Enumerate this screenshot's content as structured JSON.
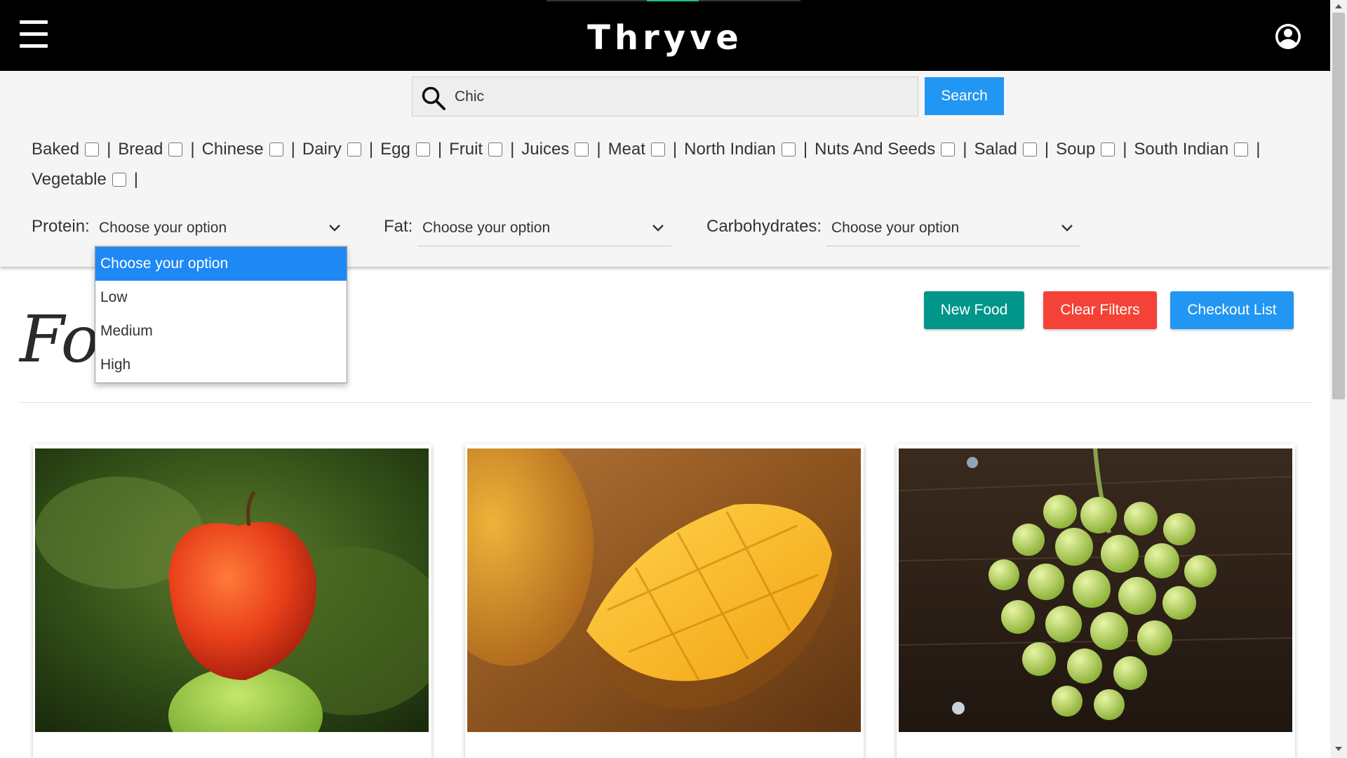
{
  "header": {
    "brand": "Thryve",
    "menu_icon": "hamburger-menu-icon",
    "account_icon": "user-circle-icon"
  },
  "search": {
    "value": "Chic",
    "icon": "search-icon",
    "button_label": "Search"
  },
  "categories": [
    "Baked",
    "Bread",
    "Chinese",
    "Dairy",
    "Egg",
    "Fruit",
    "Juices",
    "Meat",
    "North Indian",
    "Nuts And Seeds",
    "Salad",
    "Soup",
    "South Indian",
    "Vegetable"
  ],
  "separator": "|",
  "filters": {
    "protein": {
      "label": "Protein:",
      "value": "Choose your option"
    },
    "fat": {
      "label": "Fat:",
      "value": "Choose your option"
    },
    "carbs": {
      "label": "Carbohydrates:",
      "value": "Choose your option"
    }
  },
  "dropdown": {
    "options": [
      "Choose your option",
      "Low",
      "Medium",
      "High"
    ],
    "selected": "Choose your option"
  },
  "actions": {
    "new_food": "New Food",
    "clear_filters": "Clear Filters",
    "checkout_list": "Checkout List"
  },
  "section_title": "Foo                 ue :",
  "cards": [
    {
      "name": "",
      "image": "apple"
    },
    {
      "name": "",
      "image": "mango"
    },
    {
      "name": "",
      "image": "grapes"
    }
  ],
  "colors": {
    "header_bg": "#000000",
    "primary_blue": "#2196f3",
    "teal": "#00968a",
    "red": "#f44336",
    "panel_bg": "#f5f5f5"
  }
}
